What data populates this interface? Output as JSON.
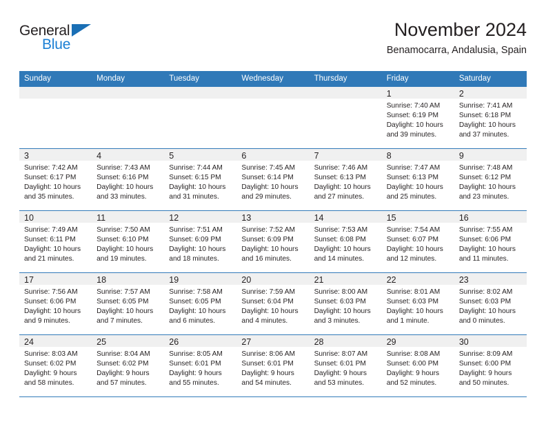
{
  "brand": {
    "name_part1": "General",
    "name_part2": "Blue",
    "accent_color": "#1b7fd4",
    "triangle_color": "#1a6fb5"
  },
  "header": {
    "month_title": "November 2024",
    "location": "Benamocarra, Andalusia, Spain"
  },
  "calendar": {
    "header_color": "#3079b8",
    "daynum_bg": "#f0f0f0",
    "weekday_headers": [
      "Sunday",
      "Monday",
      "Tuesday",
      "Wednesday",
      "Thursday",
      "Friday",
      "Saturday"
    ],
    "weeks": [
      [
        {
          "day": "",
          "sunrise": "",
          "sunset": "",
          "daylight": "",
          "empty": true
        },
        {
          "day": "",
          "sunrise": "",
          "sunset": "",
          "daylight": "",
          "empty": true
        },
        {
          "day": "",
          "sunrise": "",
          "sunset": "",
          "daylight": "",
          "empty": true
        },
        {
          "day": "",
          "sunrise": "",
          "sunset": "",
          "daylight": "",
          "empty": true
        },
        {
          "day": "",
          "sunrise": "",
          "sunset": "",
          "daylight": "",
          "empty": true
        },
        {
          "day": "1",
          "sunrise": "Sunrise: 7:40 AM",
          "sunset": "Sunset: 6:19 PM",
          "daylight": "Daylight: 10 hours and 39 minutes."
        },
        {
          "day": "2",
          "sunrise": "Sunrise: 7:41 AM",
          "sunset": "Sunset: 6:18 PM",
          "daylight": "Daylight: 10 hours and 37 minutes."
        }
      ],
      [
        {
          "day": "3",
          "sunrise": "Sunrise: 7:42 AM",
          "sunset": "Sunset: 6:17 PM",
          "daylight": "Daylight: 10 hours and 35 minutes."
        },
        {
          "day": "4",
          "sunrise": "Sunrise: 7:43 AM",
          "sunset": "Sunset: 6:16 PM",
          "daylight": "Daylight: 10 hours and 33 minutes."
        },
        {
          "day": "5",
          "sunrise": "Sunrise: 7:44 AM",
          "sunset": "Sunset: 6:15 PM",
          "daylight": "Daylight: 10 hours and 31 minutes."
        },
        {
          "day": "6",
          "sunrise": "Sunrise: 7:45 AM",
          "sunset": "Sunset: 6:14 PM",
          "daylight": "Daylight: 10 hours and 29 minutes."
        },
        {
          "day": "7",
          "sunrise": "Sunrise: 7:46 AM",
          "sunset": "Sunset: 6:13 PM",
          "daylight": "Daylight: 10 hours and 27 minutes."
        },
        {
          "day": "8",
          "sunrise": "Sunrise: 7:47 AM",
          "sunset": "Sunset: 6:13 PM",
          "daylight": "Daylight: 10 hours and 25 minutes."
        },
        {
          "day": "9",
          "sunrise": "Sunrise: 7:48 AM",
          "sunset": "Sunset: 6:12 PM",
          "daylight": "Daylight: 10 hours and 23 minutes."
        }
      ],
      [
        {
          "day": "10",
          "sunrise": "Sunrise: 7:49 AM",
          "sunset": "Sunset: 6:11 PM",
          "daylight": "Daylight: 10 hours and 21 minutes."
        },
        {
          "day": "11",
          "sunrise": "Sunrise: 7:50 AM",
          "sunset": "Sunset: 6:10 PM",
          "daylight": "Daylight: 10 hours and 19 minutes."
        },
        {
          "day": "12",
          "sunrise": "Sunrise: 7:51 AM",
          "sunset": "Sunset: 6:09 PM",
          "daylight": "Daylight: 10 hours and 18 minutes."
        },
        {
          "day": "13",
          "sunrise": "Sunrise: 7:52 AM",
          "sunset": "Sunset: 6:09 PM",
          "daylight": "Daylight: 10 hours and 16 minutes."
        },
        {
          "day": "14",
          "sunrise": "Sunrise: 7:53 AM",
          "sunset": "Sunset: 6:08 PM",
          "daylight": "Daylight: 10 hours and 14 minutes."
        },
        {
          "day": "15",
          "sunrise": "Sunrise: 7:54 AM",
          "sunset": "Sunset: 6:07 PM",
          "daylight": "Daylight: 10 hours and 12 minutes."
        },
        {
          "day": "16",
          "sunrise": "Sunrise: 7:55 AM",
          "sunset": "Sunset: 6:06 PM",
          "daylight": "Daylight: 10 hours and 11 minutes."
        }
      ],
      [
        {
          "day": "17",
          "sunrise": "Sunrise: 7:56 AM",
          "sunset": "Sunset: 6:06 PM",
          "daylight": "Daylight: 10 hours and 9 minutes."
        },
        {
          "day": "18",
          "sunrise": "Sunrise: 7:57 AM",
          "sunset": "Sunset: 6:05 PM",
          "daylight": "Daylight: 10 hours and 7 minutes."
        },
        {
          "day": "19",
          "sunrise": "Sunrise: 7:58 AM",
          "sunset": "Sunset: 6:05 PM",
          "daylight": "Daylight: 10 hours and 6 minutes."
        },
        {
          "day": "20",
          "sunrise": "Sunrise: 7:59 AM",
          "sunset": "Sunset: 6:04 PM",
          "daylight": "Daylight: 10 hours and 4 minutes."
        },
        {
          "day": "21",
          "sunrise": "Sunrise: 8:00 AM",
          "sunset": "Sunset: 6:03 PM",
          "daylight": "Daylight: 10 hours and 3 minutes."
        },
        {
          "day": "22",
          "sunrise": "Sunrise: 8:01 AM",
          "sunset": "Sunset: 6:03 PM",
          "daylight": "Daylight: 10 hours and 1 minute."
        },
        {
          "day": "23",
          "sunrise": "Sunrise: 8:02 AM",
          "sunset": "Sunset: 6:03 PM",
          "daylight": "Daylight: 10 hours and 0 minutes."
        }
      ],
      [
        {
          "day": "24",
          "sunrise": "Sunrise: 8:03 AM",
          "sunset": "Sunset: 6:02 PM",
          "daylight": "Daylight: 9 hours and 58 minutes."
        },
        {
          "day": "25",
          "sunrise": "Sunrise: 8:04 AM",
          "sunset": "Sunset: 6:02 PM",
          "daylight": "Daylight: 9 hours and 57 minutes."
        },
        {
          "day": "26",
          "sunrise": "Sunrise: 8:05 AM",
          "sunset": "Sunset: 6:01 PM",
          "daylight": "Daylight: 9 hours and 55 minutes."
        },
        {
          "day": "27",
          "sunrise": "Sunrise: 8:06 AM",
          "sunset": "Sunset: 6:01 PM",
          "daylight": "Daylight: 9 hours and 54 minutes."
        },
        {
          "day": "28",
          "sunrise": "Sunrise: 8:07 AM",
          "sunset": "Sunset: 6:01 PM",
          "daylight": "Daylight: 9 hours and 53 minutes."
        },
        {
          "day": "29",
          "sunrise": "Sunrise: 8:08 AM",
          "sunset": "Sunset: 6:00 PM",
          "daylight": "Daylight: 9 hours and 52 minutes."
        },
        {
          "day": "30",
          "sunrise": "Sunrise: 8:09 AM",
          "sunset": "Sunset: 6:00 PM",
          "daylight": "Daylight: 9 hours and 50 minutes."
        }
      ]
    ]
  }
}
